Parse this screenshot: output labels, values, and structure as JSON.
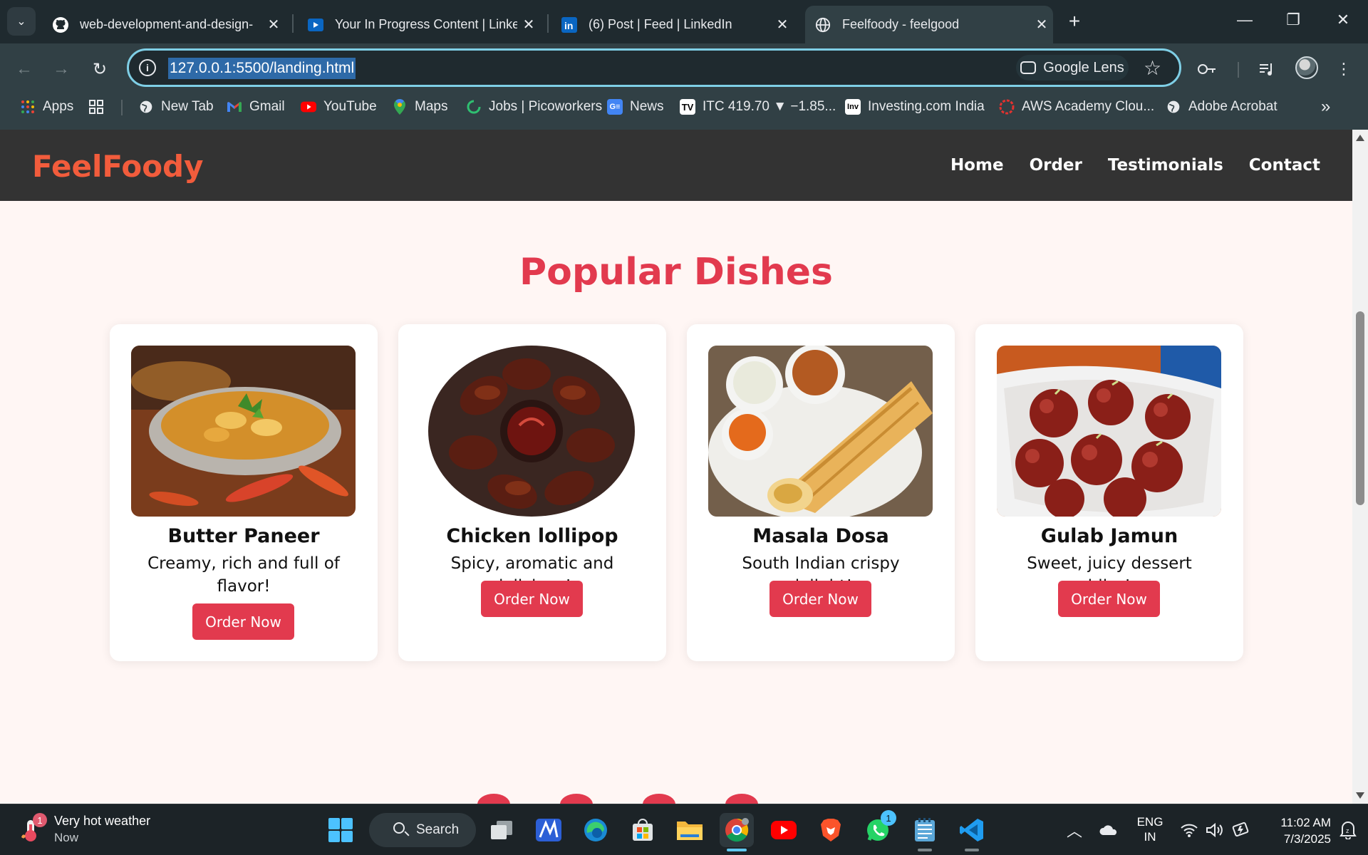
{
  "browser": {
    "tabs": [
      {
        "title": "web-development-and-design-",
        "favicon": "github-icon"
      },
      {
        "title": "Your In Progress Content | Linke",
        "favicon": "linkedin-learning-icon"
      },
      {
        "title": "(6) Post | Feed | LinkedIn",
        "favicon": "linkedin-icon"
      },
      {
        "title": "Feelfoody - feelgood",
        "favicon": "globe-icon",
        "active": true
      }
    ],
    "address": "127.0.0.1:5500/landing.html",
    "lens_label": "Google Lens",
    "bookmarks": [
      {
        "label": "Apps"
      },
      {
        "label": "New Tab"
      },
      {
        "label": "Gmail"
      },
      {
        "label": "YouTube"
      },
      {
        "label": "Maps"
      },
      {
        "label": "Jobs | Picoworkers"
      },
      {
        "label": "News"
      },
      {
        "label": "ITC 419.70 ▼ −1.85..."
      },
      {
        "label": "Investing.com India"
      },
      {
        "label": "AWS Academy Clou..."
      },
      {
        "label": "Adobe Acrobat"
      }
    ]
  },
  "site": {
    "brand": "FeelFoody",
    "nav": [
      "Home",
      "Order",
      "Testimonials",
      "Contact"
    ],
    "section_title": "Popular Dishes",
    "dishes": [
      {
        "name": "Butter Paneer",
        "desc": "Creamy, rich and full of flavor!",
        "cta": "Order Now"
      },
      {
        "name": "Chicken lollipop",
        "desc": "Spicy, aromatic and delicious!",
        "cta": "Order Now"
      },
      {
        "name": "Masala Dosa",
        "desc": "South Indian crispy delight!",
        "cta": "Order Now"
      },
      {
        "name": "Gulab Jamun",
        "desc": "Sweet, juicy dessert bliss!",
        "cta": "Order Now"
      }
    ],
    "colors": {
      "brand": "#f25c3c",
      "accent": "#e23a4e",
      "nav_bg": "#333333",
      "page_bg": "#fff6f4"
    }
  },
  "taskbar": {
    "weather": {
      "line1": "Very hot weather",
      "line2": "Now",
      "badge": "1"
    },
    "search_label": "Search",
    "whatsapp_badge": "1",
    "lang": {
      "line1": "ENG",
      "line2": "IN"
    },
    "time": "11:02 AM",
    "date": "7/3/2025"
  }
}
